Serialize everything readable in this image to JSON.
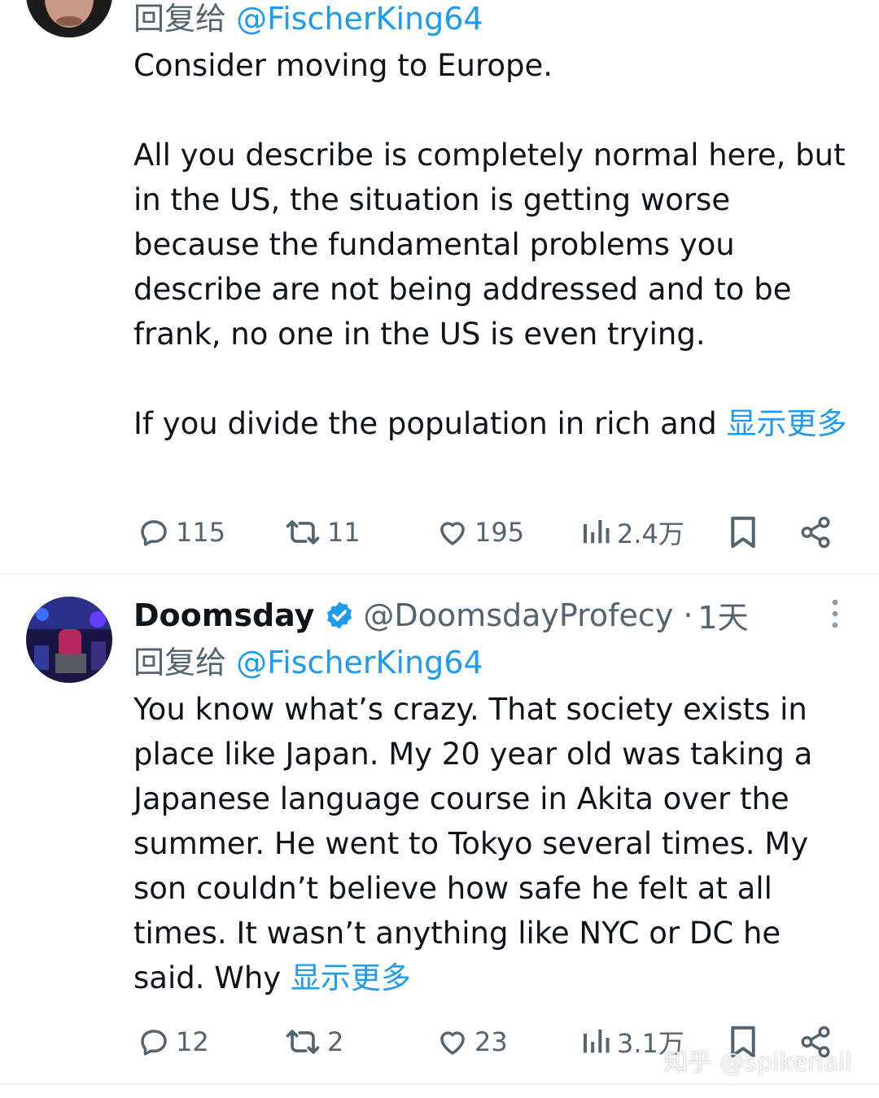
{
  "tweets": [
    {
      "reply_prefix": "回复给",
      "reply_handle": "@FischerKing64",
      "paragraphs": [
        "Consider moving to Europe.",
        "All you describe is completely normal here, but in the US, the situation is getting worse because the fundamental problems you describe are not being addressed and to be frank, no one in the US is even trying.",
        "If you divide the population in rich and"
      ],
      "show_more": "显示更多",
      "actions": {
        "replies": "115",
        "retweets": "11",
        "likes": "195",
        "views": "2.4万"
      }
    },
    {
      "display_name": "Doomsday",
      "verified": true,
      "handle": "@DoomsdayProfecy",
      "time": "1天",
      "reply_prefix": "回复给",
      "reply_handle": "@FischerKing64",
      "text": "You know what’s crazy. That society exists in place like Japan. My 20 year old was taking a Japanese language course in Akita over the summer. He went to Tokyo several times. My son couldn’t believe how safe he felt at all times. It wasn’t anything like NYC or DC he said. Why",
      "show_more": "显示更多",
      "actions": {
        "replies": "12",
        "retweets": "2",
        "likes": "23",
        "views": "3.1万"
      }
    }
  ],
  "separator": "·",
  "watermark": "知乎 @spikenail",
  "icons": [
    "reply-icon",
    "retweet-icon",
    "like-icon",
    "views-icon",
    "bookmark-icon",
    "share-icon",
    "verified-badge-icon",
    "more-options-icon"
  ],
  "colors": {
    "link": "#1d9bf0",
    "secondary": "#536471",
    "text": "#0f1419",
    "divider": "#eff3f4"
  }
}
